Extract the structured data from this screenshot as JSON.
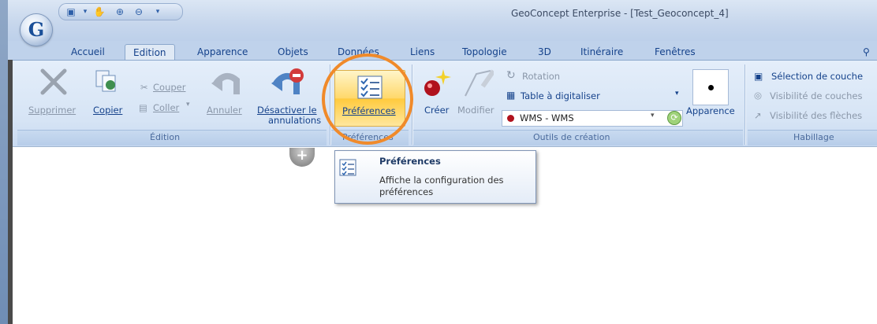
{
  "window": {
    "title": "GeoConcept Enterprise - [Test_Geoconcept_4]",
    "app_button_letter": "G"
  },
  "tabs": [
    {
      "label": "Accueil"
    },
    {
      "label": "Edition"
    },
    {
      "label": "Apparence"
    },
    {
      "label": "Objets"
    },
    {
      "label": "Données"
    },
    {
      "label": "Liens"
    },
    {
      "label": "Topologie"
    },
    {
      "label": "3D"
    },
    {
      "label": "Itinéraire"
    },
    {
      "label": "Fenêtres"
    }
  ],
  "active_tab": "Edition",
  "ribbon": {
    "edition": {
      "supprimer": "Supprimer",
      "copier": "Copier",
      "couper": "Couper",
      "coller": "Coller",
      "annuler": "Annuler",
      "desactiver_line1": "Désactiver le",
      "desactiver_line2": "annulations",
      "group_label": "Édition"
    },
    "preferences": {
      "button_label": "Préférences",
      "group_label": "Préférences"
    },
    "outils_creation": {
      "creer": "Créer",
      "modifier": "Modifier",
      "rotation": "Rotation",
      "table_digitaliser": "Table à digitaliser",
      "combo_value": "WMS - WMS",
      "apparence": "Apparence",
      "group_label": "Outils de création"
    },
    "habillage": {
      "selection_couche": "Sélection de couche",
      "visibilite_couches": "Visibilité de couches",
      "visibilite_fleches": "Visibilité des flèches",
      "group_label": "Habillage"
    }
  },
  "tooltip": {
    "title": "Préférences",
    "line1": "Affiche la configuration des",
    "line2": "préférences"
  },
  "colors": {
    "highlight_circle": "#f08a2a",
    "ribbon_text": "#15428b"
  }
}
